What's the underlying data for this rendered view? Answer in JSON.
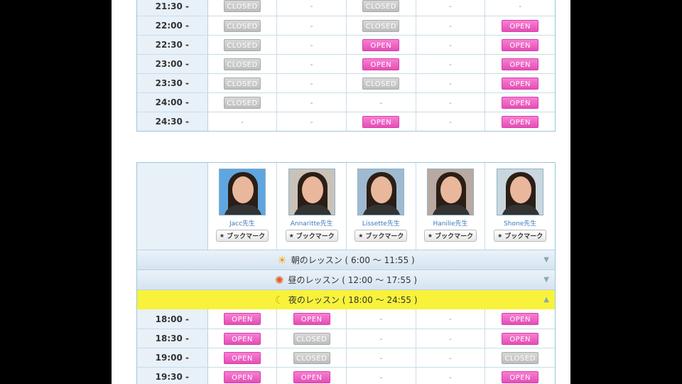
{
  "top_schedule": [
    {
      "time": "21:30 -",
      "cells": [
        "CLOSED",
        "-",
        "CLOSED",
        "-",
        "-"
      ]
    },
    {
      "time": "22:00 -",
      "cells": [
        "CLOSED",
        "-",
        "CLOSED",
        "-",
        "OPEN"
      ]
    },
    {
      "time": "22:30 -",
      "cells": [
        "CLOSED",
        "-",
        "OPEN",
        "-",
        "OPEN"
      ]
    },
    {
      "time": "23:00 -",
      "cells": [
        "CLOSED",
        "-",
        "OPEN",
        "-",
        "OPEN"
      ]
    },
    {
      "time": "23:30 -",
      "cells": [
        "CLOSED",
        "-",
        "CLOSED",
        "-",
        "OPEN"
      ]
    },
    {
      "time": "24:00 -",
      "cells": [
        "CLOSED",
        "-",
        "-",
        "-",
        "OPEN"
      ]
    },
    {
      "time": "24:30 -",
      "cells": [
        "-",
        "-",
        "OPEN",
        "-",
        "OPEN"
      ]
    }
  ],
  "teachers": [
    {
      "name": "Jacc先生",
      "bookmark": "ブックマーク"
    },
    {
      "name": "Annaritte先生",
      "bookmark": "ブックマーク"
    },
    {
      "name": "Lissette先生",
      "bookmark": "ブックマーク"
    },
    {
      "name": "Hanilie先生",
      "bookmark": "ブックマーク"
    },
    {
      "name": "Shone先生",
      "bookmark": "ブックマーク"
    }
  ],
  "sections": {
    "morning": "朝のレッスン ( 6:00 ～ 11:55 )",
    "afternoon": "昼のレッスン ( 12:00 ～ 17:55 )",
    "evening": "夜のレッスン ( 18:00 ～ 24:55 )"
  },
  "bottom_schedule": [
    {
      "time": "18:00 -",
      "cells": [
        "OPEN",
        "OPEN",
        "-",
        "-",
        "OPEN"
      ]
    },
    {
      "time": "18:30 -",
      "cells": [
        "OPEN",
        "CLOSED",
        "-",
        "-",
        "OPEN"
      ]
    },
    {
      "time": "19:00 -",
      "cells": [
        "OPEN",
        "CLOSED",
        "-",
        "-",
        "CLOSED"
      ]
    },
    {
      "time": "19:30 -",
      "cells": [
        "OPEN",
        "OPEN",
        "-",
        "-",
        "OPEN"
      ]
    }
  ],
  "icons": {
    "morning": "sunrise-icon",
    "afternoon": "sun-icon",
    "evening": "moon-icon",
    "bookmark": "star-icon"
  },
  "colors": {
    "open": "#e54eb6",
    "closed": "#bdbdbd",
    "evening_bar": "#f8f23b"
  }
}
